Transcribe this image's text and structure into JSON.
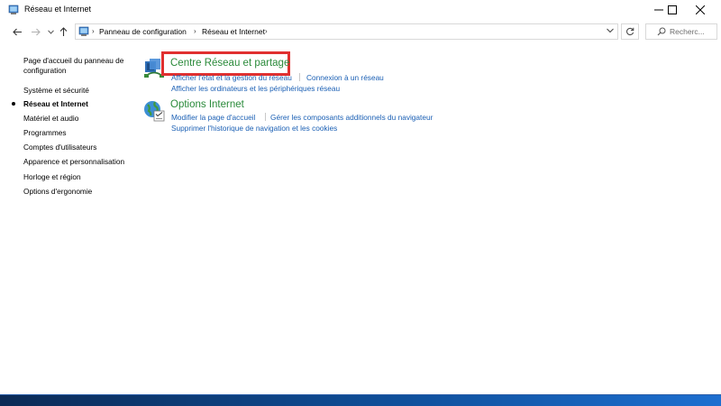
{
  "window": {
    "title": "Réseau et Internet",
    "accent_color": "#2a8a3a",
    "link_color": "#1a5fb4",
    "highlight_color": "#e03030"
  },
  "address": {
    "breadcrumbs": [
      "Panneau de configuration",
      "Réseau et Internet"
    ]
  },
  "search": {
    "placeholder": "Recherc..."
  },
  "sidebar": {
    "items": [
      {
        "label": "Page d'accueil du panneau de configuration",
        "active": false
      },
      {
        "label": "Système et sécurité",
        "active": false
      },
      {
        "label": "Réseau et Internet",
        "active": true
      },
      {
        "label": "Matériel et audio",
        "active": false
      },
      {
        "label": "Programmes",
        "active": false
      },
      {
        "label": "Comptes d'utilisateurs",
        "active": false
      },
      {
        "label": "Apparence et personnalisation",
        "active": false
      },
      {
        "label": "Horloge et région",
        "active": false
      },
      {
        "label": "Options d'ergonomie",
        "active": false
      }
    ]
  },
  "categories": [
    {
      "title": "Centre Réseau et partage",
      "icon": "network-sharing-icon",
      "links": [
        "Afficher l'état et la gestion du réseau",
        "Connexion à un réseau",
        "Afficher les ordinateurs et les périphériques réseau"
      ]
    },
    {
      "title": "Options Internet",
      "icon": "internet-options-icon",
      "links": [
        "Modifier la page d'accueil",
        "Gérer les composants additionnels du navigateur",
        "Supprimer l'historique de navigation et les cookies"
      ]
    }
  ]
}
